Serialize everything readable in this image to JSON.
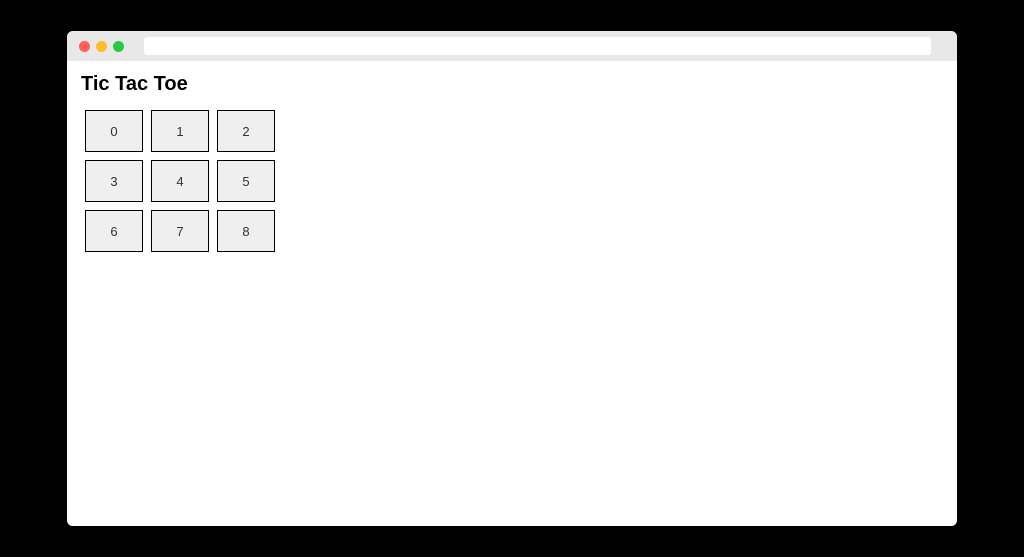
{
  "page": {
    "title": "Tic Tac Toe"
  },
  "board": {
    "cells": [
      "0",
      "1",
      "2",
      "3",
      "4",
      "5",
      "6",
      "7",
      "8"
    ]
  }
}
